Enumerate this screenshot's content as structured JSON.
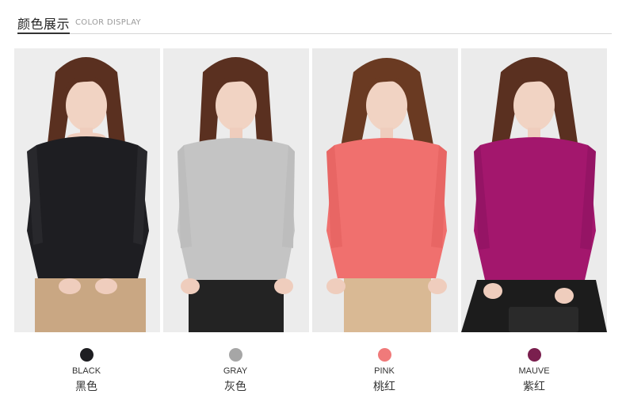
{
  "header": {
    "title_cn": "颜色展示",
    "title_en": "COLOR DISPLAY"
  },
  "colors": [
    {
      "en": "BLACK",
      "cn": "黑色",
      "hex": "#1e1e22",
      "skirt": "#c9a783",
      "bg": "#e9e9e9"
    },
    {
      "en": "GRAY",
      "cn": "灰色",
      "hex": "#a6a6a6",
      "sweater": "#c4c4c4",
      "skirt": "#232323",
      "bg": "#ececec"
    },
    {
      "en": "PINK",
      "cn": "桃红",
      "hex": "#f07a7a",
      "sweater": "#f0706e",
      "skirt": "#d9b994",
      "bg": "#eaeaea"
    },
    {
      "en": "MAUVE",
      "cn": "紫红",
      "hex": "#7a1f4e",
      "sweater": "#a3176d",
      "skirt": "#1c1c1c",
      "bg": "#ebebeb"
    }
  ]
}
